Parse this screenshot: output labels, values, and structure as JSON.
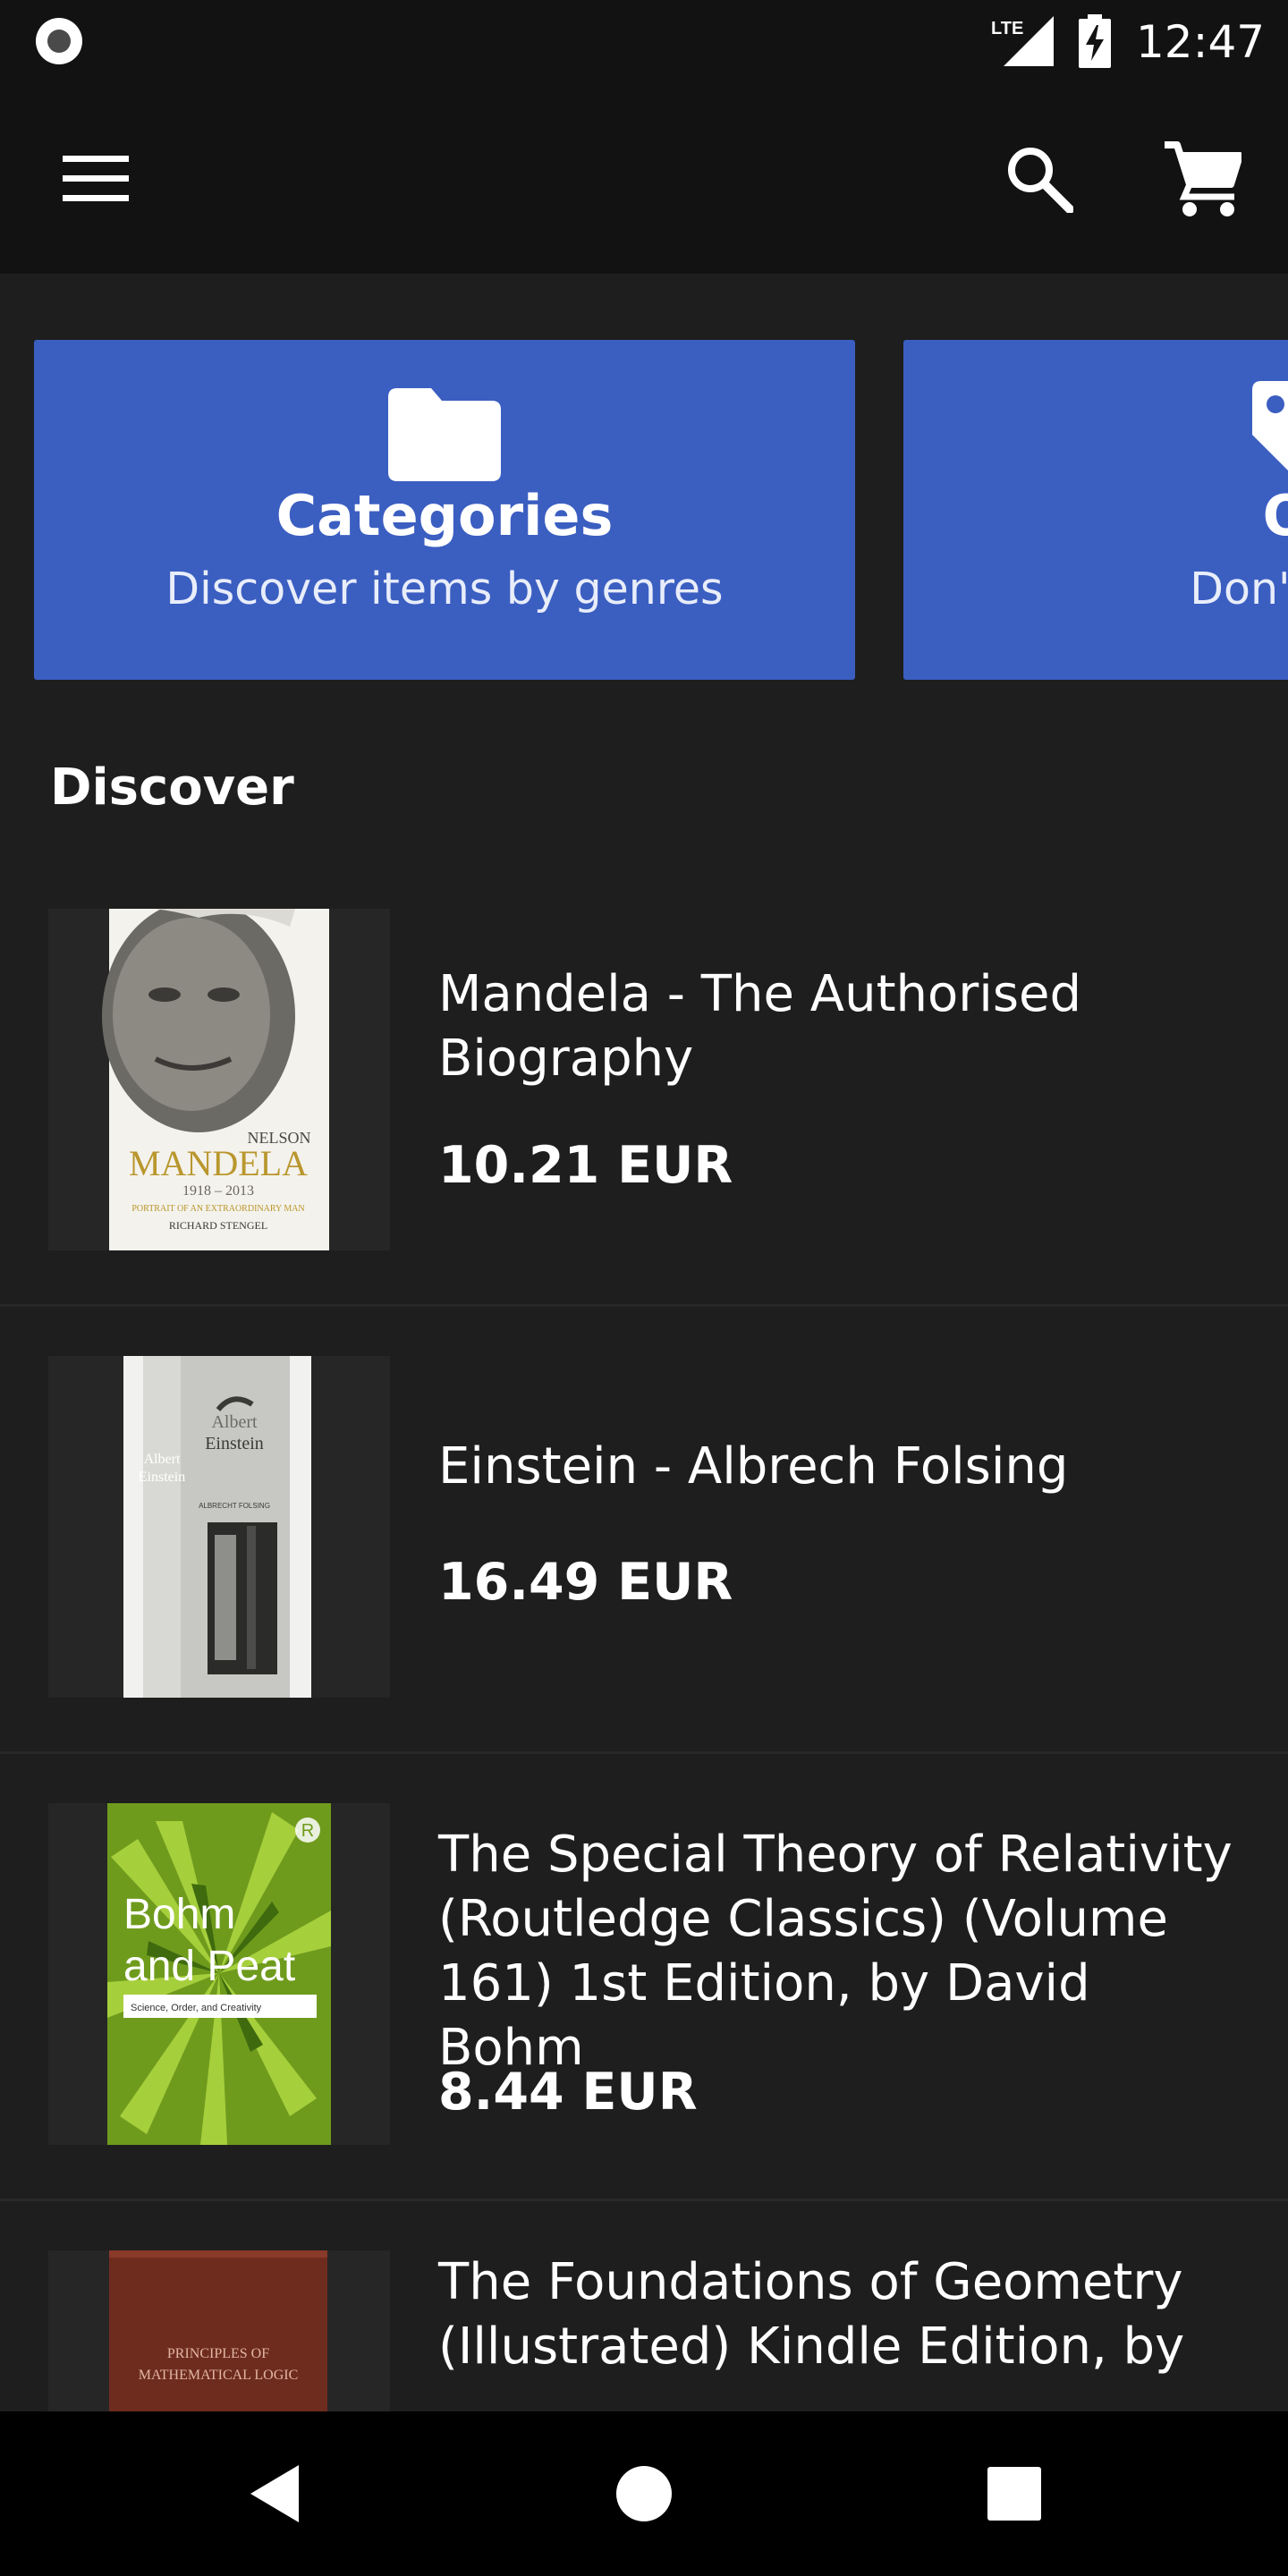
{
  "status_bar": {
    "time": "12:47",
    "network": "LTE"
  },
  "app_bar": {
    "menu_icon": "menu-icon",
    "search_icon": "search-icon",
    "cart_icon": "cart-icon"
  },
  "cards": [
    {
      "icon": "folder-icon",
      "title": "Categories",
      "subtitle": "Discover items by genres"
    },
    {
      "icon": "tag-icon",
      "title": "On",
      "subtitle": "Don't miss"
    }
  ],
  "section_title": "Discover",
  "items": [
    {
      "title": "Mandela - The Authorised Biography",
      "price": "10.21 EUR"
    },
    {
      "title": "Einstein - Albrech Folsing",
      "price": "16.49 EUR"
    },
    {
      "title": "The Special Theory of Relativity (Routledge Classics) (Volume 161) 1st Edition, by David Bohm",
      "price": "8.44 EUR"
    },
    {
      "title": "The Foundations of Geometry (Illustrated) Kindle Edition, by",
      "price": ""
    }
  ],
  "covers": {
    "mandela": {
      "line1": "NELSON",
      "line2": "MANDELA",
      "line3": "1918 – 2013",
      "line4": "PORTRAIT OF AN EXTRAORDINARY MAN",
      "line5": "RICHARD STENGEL"
    },
    "einstein": {
      "spine1": "Albert",
      "spine2": "Einstein",
      "face1": "Albert",
      "face2": "Einstein",
      "author": "ALBRECHT FOLSING"
    },
    "bohm": {
      "line1": "Bohm",
      "line2": "and Peat",
      "subtitle": "Science, Order, and Creativity",
      "badge": "R"
    },
    "geometry": {
      "line1": "PRINCIPLES OF",
      "line2": "MATHEMATICAL LOGIC"
    }
  },
  "colors": {
    "background": "#1e1e1e",
    "bar": "#121212",
    "card_blue": "#3b5ec1"
  }
}
